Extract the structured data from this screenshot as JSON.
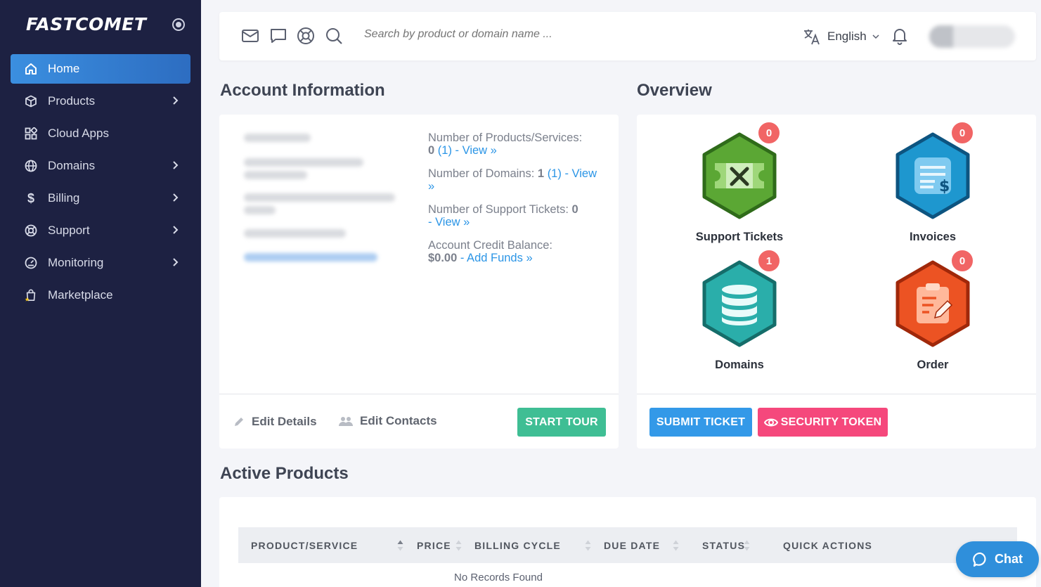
{
  "brand": {
    "logo_text": "FASTCOMET"
  },
  "sidebar": {
    "items": [
      {
        "label": "Home",
        "icon": "home-icon",
        "active": true,
        "has_submenu": false
      },
      {
        "label": "Products",
        "icon": "box-icon",
        "active": false,
        "has_submenu": true
      },
      {
        "label": "Cloud Apps",
        "icon": "apps-icon",
        "active": false,
        "has_submenu": false
      },
      {
        "label": "Domains",
        "icon": "globe-icon",
        "active": false,
        "has_submenu": true
      },
      {
        "label": "Billing",
        "icon": "dollar-icon",
        "active": false,
        "has_submenu": true
      },
      {
        "label": "Support",
        "icon": "lifebuoy-icon",
        "active": false,
        "has_submenu": true
      },
      {
        "label": "Monitoring",
        "icon": "gauge-icon",
        "active": false,
        "has_submenu": true
      },
      {
        "label": "Marketplace",
        "icon": "shopping-bag-star-icon",
        "active": false,
        "has_submenu": false
      }
    ]
  },
  "topbar": {
    "search_placeholder": "Search by product or domain name ...",
    "language": "English",
    "icons": [
      "mail-icon",
      "chat-bubble-icon",
      "support-ring-icon",
      "search-icon",
      "translate-icon",
      "bell-icon"
    ]
  },
  "account": {
    "title": "Account Information",
    "stats": {
      "products_label": "Number of Products/Services:",
      "products_value": "0",
      "products_link": "(1) - View »",
      "domains_label": "Number of Domains:",
      "domains_value": "1",
      "domains_link": "(1) - View »",
      "tickets_label": "Number of Support Tickets:",
      "tickets_value": "0",
      "tickets_link": "- View »",
      "credit_label": "Account Credit Balance:",
      "credit_value": "$0.00",
      "credit_link": "- Add Funds »"
    },
    "edit_details": "Edit Details",
    "edit_contacts": "Edit Contacts",
    "start_tour": "START TOUR"
  },
  "overview": {
    "title": "Overview",
    "tiles": [
      {
        "label": "Support Tickets",
        "count": "0",
        "color": "#5ba734",
        "icon": "ticket-tools-icon"
      },
      {
        "label": "Invoices",
        "count": "0",
        "color": "#1e97cf",
        "icon": "invoice-dollar-icon"
      },
      {
        "label": "Domains",
        "count": "1",
        "color": "#2aaeaa",
        "icon": "database-icon"
      },
      {
        "label": "Order",
        "count": "0",
        "color": "#ec5323",
        "icon": "clipboard-edit-icon"
      }
    ],
    "submit_ticket": "SUBMIT TICKET",
    "security_token": "SECURITY TOKEN"
  },
  "products": {
    "title": "Active Products",
    "columns": [
      "PRODUCT/SERVICE",
      "PRICE",
      "BILLING CYCLE",
      "DUE DATE",
      "STATUS",
      "QUICK ACTIONS"
    ],
    "empty_text": "No Records Found"
  },
  "chat": {
    "label": "Chat"
  },
  "colors": {
    "sidebar_bg": "#1d2142",
    "accent_blue": "#2b95e6",
    "tour_green": "#3fbe94",
    "token_pink": "#f5487c",
    "badge_red": "#f16565"
  }
}
